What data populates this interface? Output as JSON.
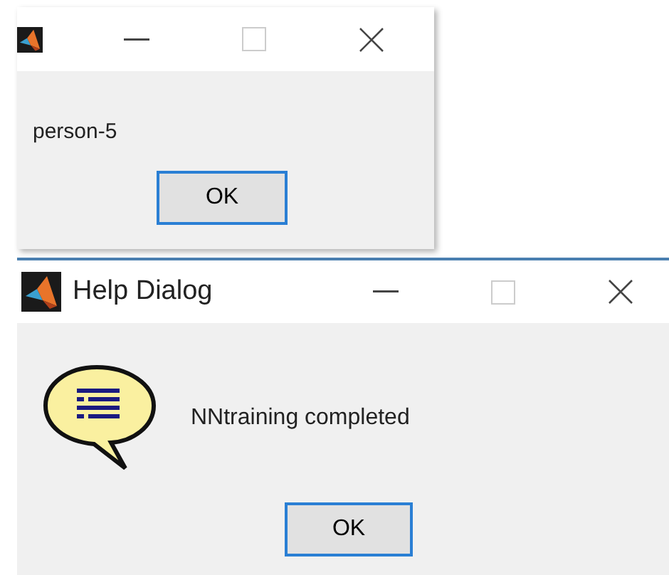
{
  "windows": [
    {
      "kind": "message",
      "message": "person-5",
      "buttons": [
        {
          "label": "OK",
          "focused": true
        }
      ]
    },
    {
      "kind": "help",
      "title": "Help Dialog",
      "message": "NNtraining completed",
      "buttons": [
        {
          "label": "OK",
          "focused": true
        }
      ]
    }
  ]
}
